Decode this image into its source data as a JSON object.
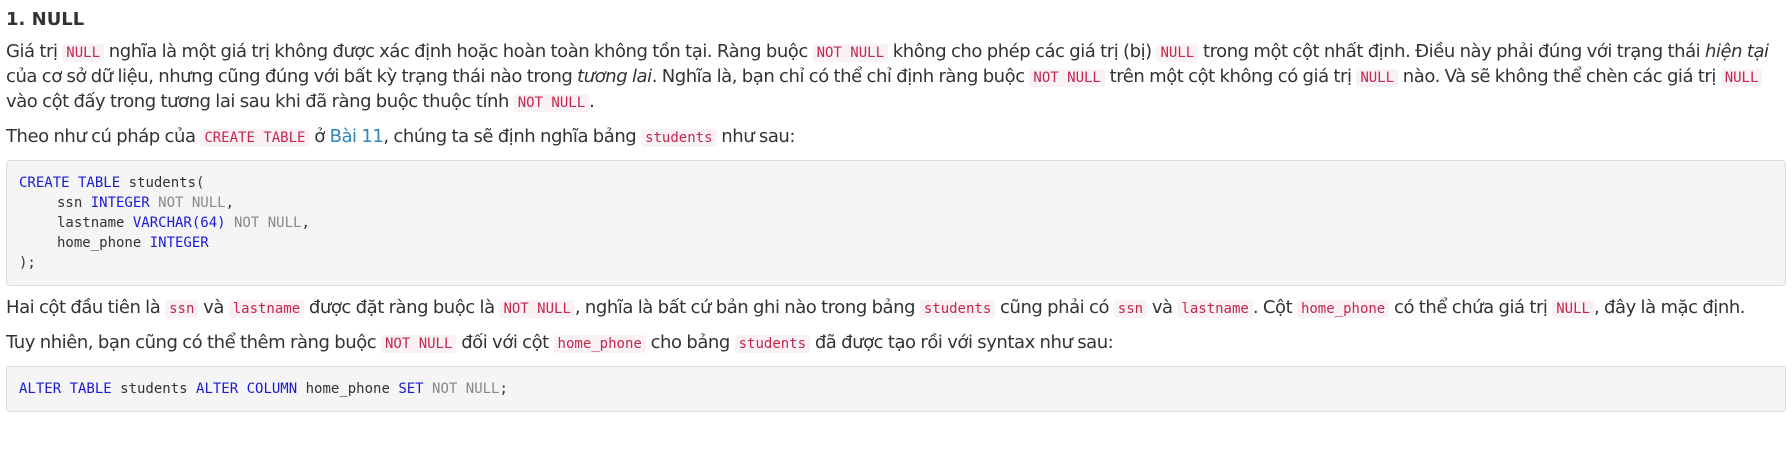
{
  "heading": "1. NULL",
  "p1": {
    "t1": "Giá trị ",
    "c1": "NULL",
    "t2": " nghĩa là một giá trị không được xác định hoặc hoàn toàn không tồn tại. Ràng buộc ",
    "c2": "NOT NULL",
    "t3": " không cho phép các giá trị (bị) ",
    "c3": "NULL",
    "t4": " trong một cột nhất định. Điều này phải đúng với trạng thái ",
    "e1": "hiện tại",
    "t5": " của cơ sở dữ liệu, nhưng cũng đúng với bất kỳ trạng thái nào trong ",
    "e2": "tương lai",
    "t6": ". Nghĩa là, bạn chỉ có thể chỉ định ràng buộc ",
    "c4": "NOT NULL",
    "t7": " trên một cột không có giá trị ",
    "c5": "NULL",
    "t8": " nào. Và sẽ không thể chèn các giá trị ",
    "c6": "NULL",
    "t9": " vào cột đấy trong tương lai sau khi đã ràng buộc thuộc tính ",
    "c7": "NOT NULL",
    "t10": "."
  },
  "p2": {
    "t1": "Theo như cú pháp của ",
    "c1": "CREATE TABLE",
    "t2": " ở ",
    "link": "Bài 11",
    "t3": ", chúng ta sẽ định nghĩa bảng ",
    "c2": "students",
    "t4": " như sau:"
  },
  "code1": {
    "l1_kw": "CREATE TABLE",
    "l1_rest": " students(",
    "l2_col": "ssn ",
    "l2_type": "INTEGER",
    "l2_nn": " NOT NULL",
    "l2_end": ",",
    "l3_col": "lastname ",
    "l3_type": "VARCHAR(64)",
    "l3_nn": " NOT NULL",
    "l3_end": ",",
    "l4_col": "home_phone ",
    "l4_type": "INTEGER",
    "l5": ");"
  },
  "p3": {
    "t1": "Hai cột đầu tiên là ",
    "c1": "ssn",
    "t2": " và ",
    "c2": "lastname",
    "t3": " được đặt ràng buộc là ",
    "c3": "NOT NULL",
    "t4": ", nghĩa là bất cứ bản ghi nào trong bảng ",
    "c4": "students",
    "t5": " cũng phải có ",
    "c5": "ssn",
    "t6": " và ",
    "c6": "lastname",
    "t7": ". Cột ",
    "c7": "home_phone",
    "t8": " có thể chứa giá trị ",
    "c8": "NULL",
    "t9": ", đây là mặc định."
  },
  "p4": {
    "t1": "Tuy nhiên, bạn cũng có thể thêm ràng buộc ",
    "c1": "NOT NULL",
    "t2": " đối với cột ",
    "c2": "home_phone",
    "t3": " cho bảng ",
    "c3": "students",
    "t4": " đã được tạo rồi với syntax như sau:"
  },
  "code2": {
    "kw1": "ALTER TABLE",
    "t1": " students ",
    "kw2": "ALTER COLUMN",
    "t2": " home_phone ",
    "kw3": "SET",
    "nn": " NOT NULL",
    "end": ";"
  }
}
